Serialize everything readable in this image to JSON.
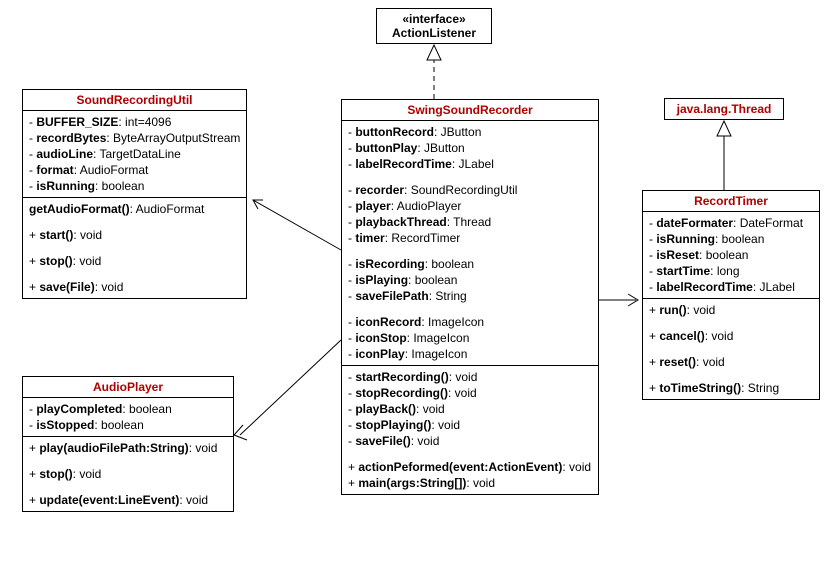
{
  "interface": {
    "stereotype": "«interface»",
    "name": "ActionListener"
  },
  "thread": {
    "name": "java.lang.Thread"
  },
  "soundRecordingUtil": {
    "name": "SoundRecordingUtil",
    "attrs": [
      {
        "vis": "-",
        "name": "BUFFER_SIZE",
        "type": "int=4096"
      },
      {
        "vis": "-",
        "name": "recordBytes",
        "type": "ByteArrayOutputStream"
      },
      {
        "vis": "-",
        "name": "audioLine",
        "type": "TargetDataLine"
      },
      {
        "vis": "-",
        "name": "format",
        "type": "AudioFormat"
      },
      {
        "vis": "-",
        "name": "isRunning",
        "type": "boolean"
      }
    ],
    "ops": [
      {
        "vis": "",
        "name": "getAudioFormat()",
        "ret": "AudioFormat"
      },
      {
        "vis": "+",
        "name": "start()",
        "ret": "void"
      },
      {
        "vis": "+",
        "name": "stop()",
        "ret": "void"
      },
      {
        "vis": "+",
        "name": "save(File)",
        "ret": "void"
      }
    ]
  },
  "audioPlayer": {
    "name": "AudioPlayer",
    "attrs": [
      {
        "vis": "-",
        "name": "playCompleted",
        "type": "boolean"
      },
      {
        "vis": "-",
        "name": "isStopped",
        "type": "boolean"
      }
    ],
    "ops": [
      {
        "vis": "+",
        "name": "play(audioFilePath:String)",
        "ret": "void"
      },
      {
        "vis": "+",
        "name": "stop()",
        "ret": "void"
      },
      {
        "vis": "+",
        "name": "update(event:LineEvent)",
        "ret": "void"
      }
    ]
  },
  "swingSoundRecorder": {
    "name": "SwingSoundRecorder",
    "attrs1": [
      {
        "vis": "-",
        "name": "buttonRecord",
        "type": "JButton"
      },
      {
        "vis": "-",
        "name": "buttonPlay",
        "type": "JButton"
      },
      {
        "vis": "-",
        "name": "labelRecordTime",
        "type": "JLabel"
      }
    ],
    "attrs2": [
      {
        "vis": "-",
        "name": "recorder",
        "type": "SoundRecordingUtil"
      },
      {
        "vis": "-",
        "name": "player",
        "type": "AudioPlayer"
      },
      {
        "vis": "-",
        "name": "playbackThread",
        "type": "Thread"
      },
      {
        "vis": "-",
        "name": "timer",
        "type": "RecordTimer"
      }
    ],
    "attrs3": [
      {
        "vis": "-",
        "name": "isRecording",
        "type": "boolean"
      },
      {
        "vis": "-",
        "name": "isPlaying",
        "type": "boolean"
      },
      {
        "vis": "-",
        "name": "saveFilePath",
        "type": "String"
      }
    ],
    "attrs4": [
      {
        "vis": "-",
        "name": "iconRecord",
        "type": "ImageIcon"
      },
      {
        "vis": "-",
        "name": "iconStop",
        "type": "ImageIcon"
      },
      {
        "vis": "-",
        "name": "iconPlay",
        "type": "ImageIcon"
      }
    ],
    "ops1": [
      {
        "vis": "-",
        "name": "startRecording()",
        "ret": "void"
      },
      {
        "vis": "-",
        "name": "stopRecording()",
        "ret": "void"
      },
      {
        "vis": "-",
        "name": "playBack()",
        "ret": "void"
      },
      {
        "vis": "-",
        "name": "stopPlaying()",
        "ret": "void"
      },
      {
        "vis": "-",
        "name": "saveFile()",
        "ret": "void"
      }
    ],
    "ops2": [
      {
        "vis": "+",
        "name": "actionPeformed(event:ActionEvent)",
        "ret": "void"
      },
      {
        "vis": "+",
        "name": "main(args:String[])",
        "ret": "void"
      }
    ]
  },
  "recordTimer": {
    "name": "RecordTimer",
    "attrs": [
      {
        "vis": "-",
        "name": "dateFormater",
        "type": "DateFormat"
      },
      {
        "vis": "-",
        "name": "isRunning",
        "type": "boolean"
      },
      {
        "vis": "-",
        "name": "isReset",
        "type": "boolean"
      },
      {
        "vis": "-",
        "name": "startTime",
        "type": "long"
      },
      {
        "vis": "-",
        "name": "labelRecordTime",
        "type": "JLabel"
      }
    ],
    "ops": [
      {
        "vis": "+",
        "name": "run()",
        "ret": "void"
      },
      {
        "vis": "+",
        "name": "cancel()",
        "ret": "void"
      },
      {
        "vis": "+",
        "name": "reset()",
        "ret": "void"
      },
      {
        "vis": "+",
        "name": "toTimeString()",
        "ret": "String"
      }
    ]
  }
}
